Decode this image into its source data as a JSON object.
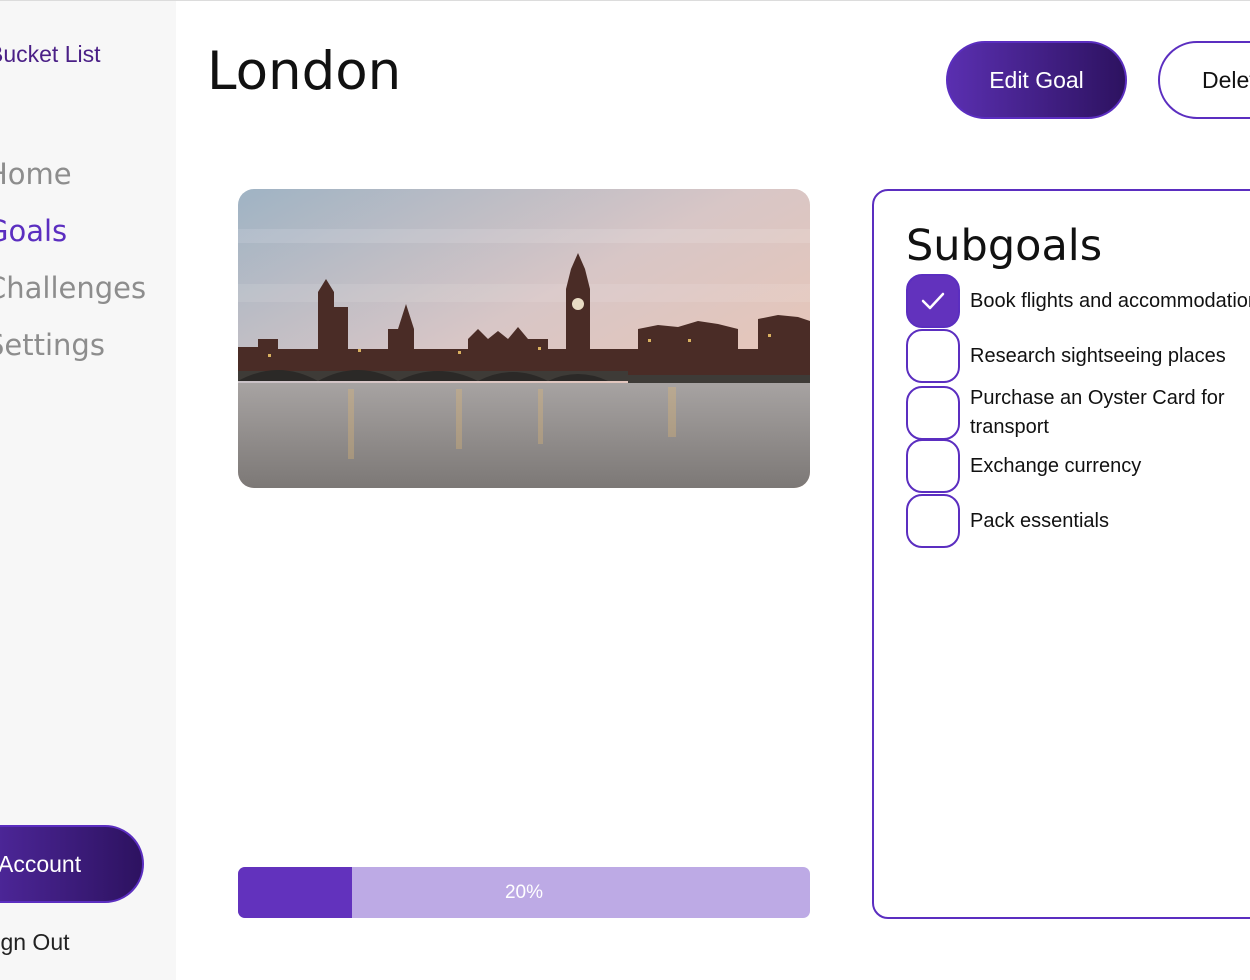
{
  "app": {
    "brand": "Bucket List"
  },
  "sidebar": {
    "nav": [
      {
        "label": "Home",
        "active": false
      },
      {
        "label": "Goals",
        "active": true
      },
      {
        "label": "Challenges",
        "active": false
      },
      {
        "label": "Settings",
        "active": false
      }
    ],
    "account_label": "Account",
    "signout_label": "Sign Out"
  },
  "header": {
    "title": "London",
    "edit_label": "Edit Goal",
    "delete_label": "Delete"
  },
  "goal_image": {
    "subject": "Westminster Bridge and Big Ben at dusk"
  },
  "progress": {
    "percent": 20,
    "label": "20%"
  },
  "subgoals": {
    "title": "Subgoals",
    "items": [
      {
        "text": "Book flights and accommodation",
        "checked": true
      },
      {
        "text": "Research sightseeing places",
        "checked": false
      },
      {
        "text": "Purchase an Oyster Card for transport",
        "checked": false
      },
      {
        "text": "Exchange currency",
        "checked": false
      },
      {
        "text": "Pack essentials",
        "checked": false
      }
    ]
  },
  "colors": {
    "accent": "#5b2ec0",
    "accent_dark": "#2d1260",
    "progress_track": "#bdaae5",
    "sidebar_bg": "#f7f7f7",
    "nav_inactive": "#8d8d8d"
  }
}
